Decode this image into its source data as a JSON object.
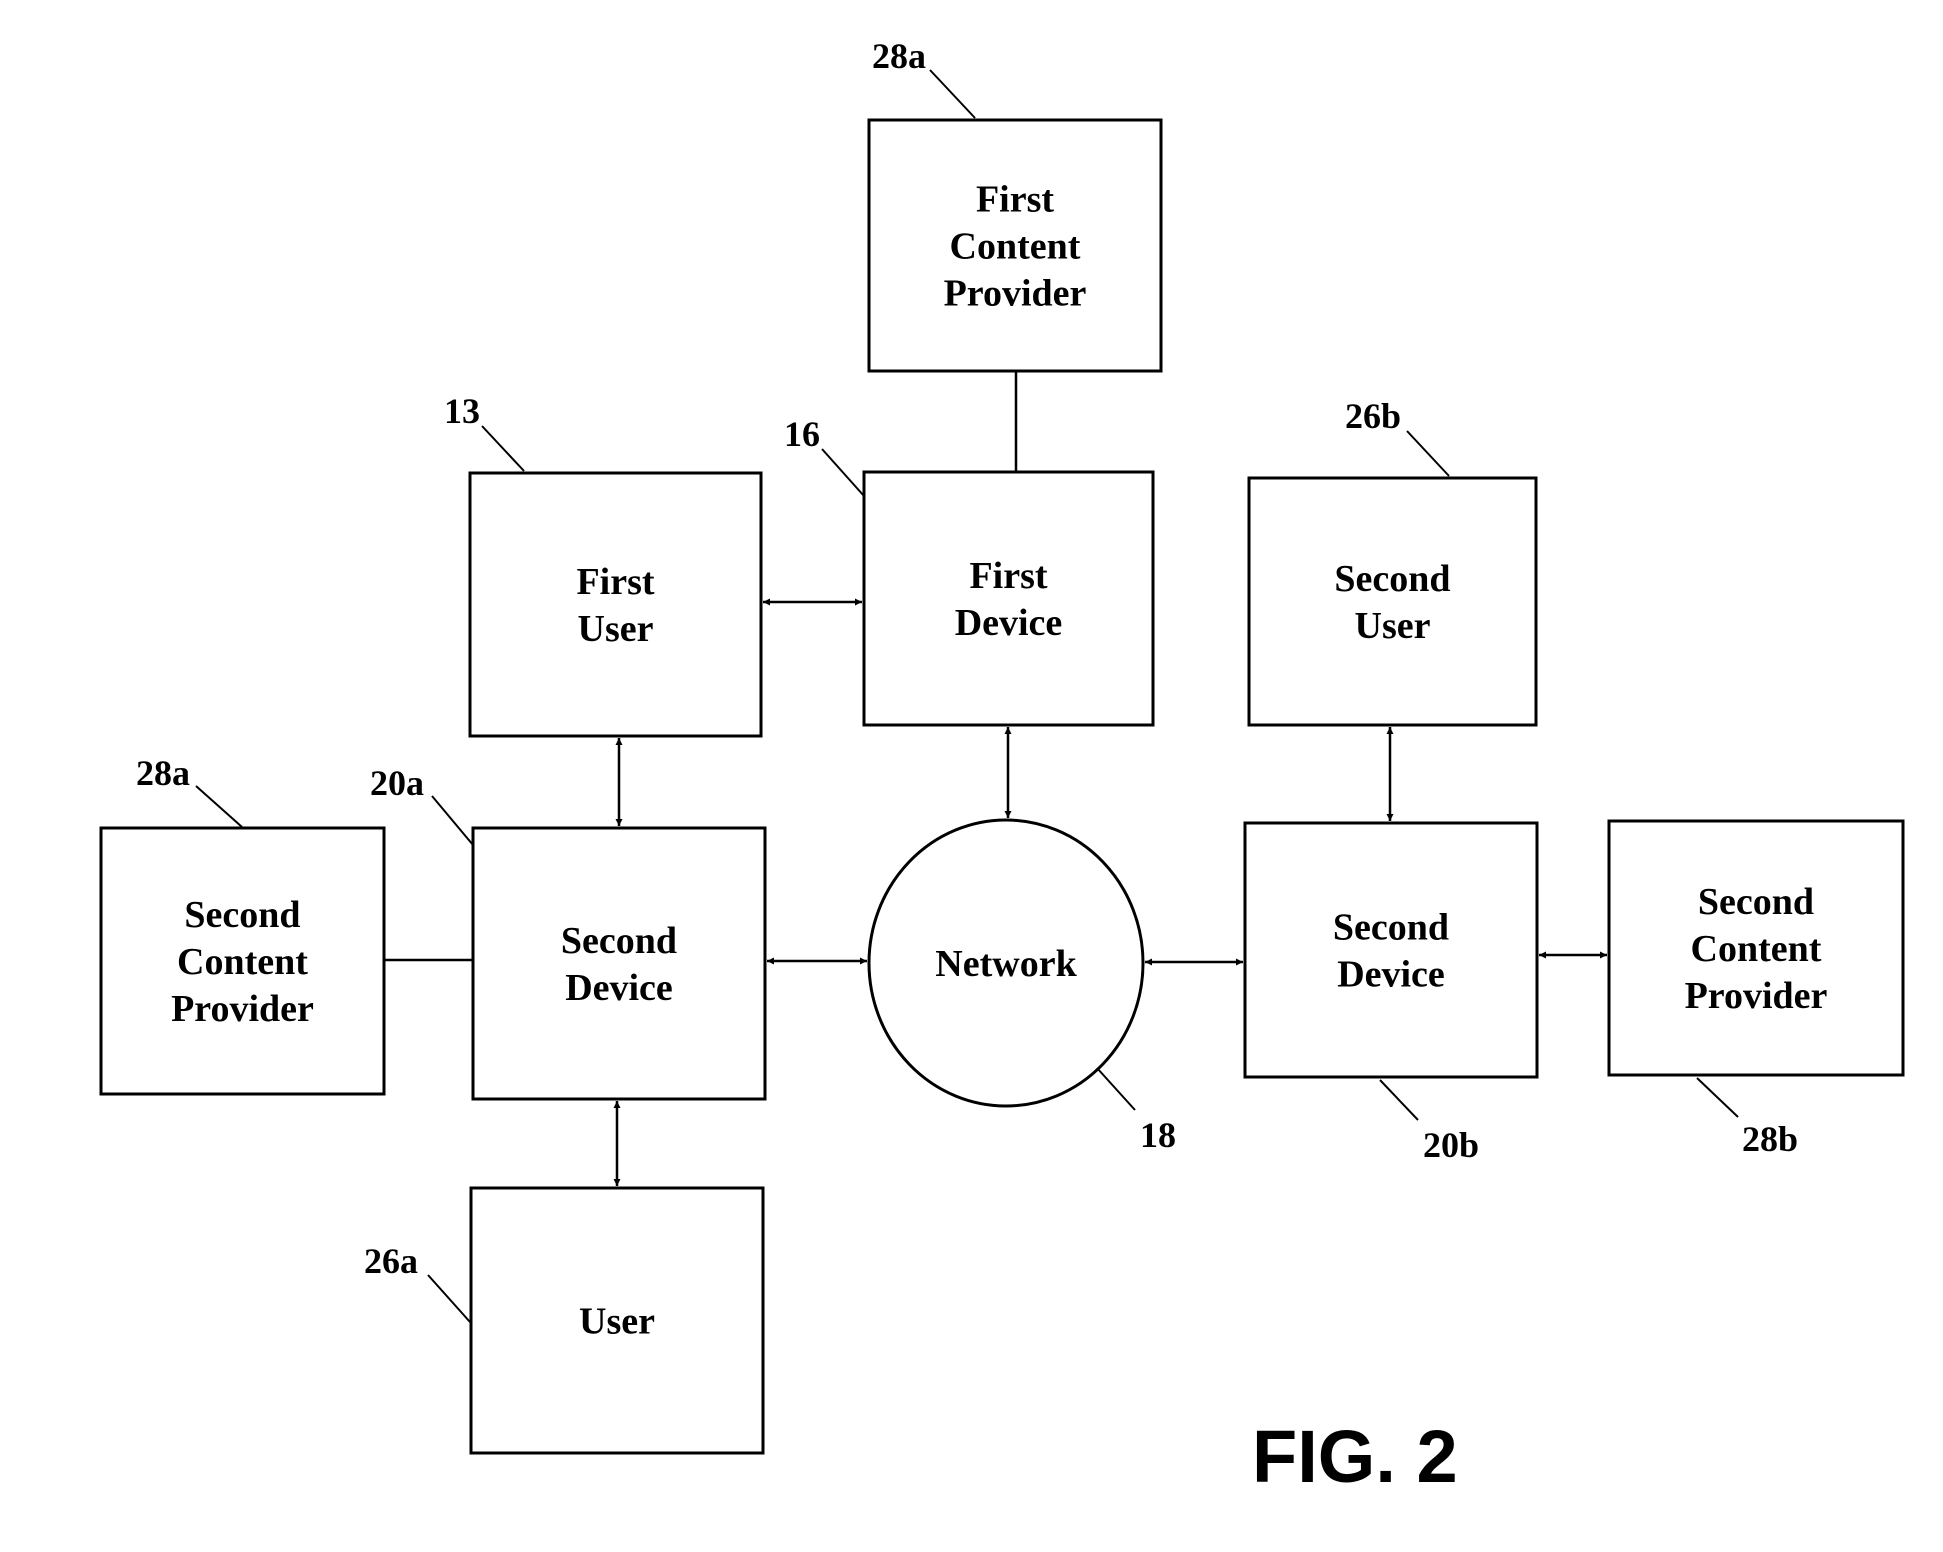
{
  "figure": {
    "title": "FIG. 2"
  },
  "nodes": [
    {
      "id": "first-content-provider",
      "ref": "28a",
      "lines": [
        "First",
        "Content",
        "Provider"
      ]
    },
    {
      "id": "first-user",
      "ref": "13",
      "lines": [
        "First",
        "User"
      ]
    },
    {
      "id": "first-device",
      "ref": "16",
      "lines": [
        "First",
        "Device"
      ]
    },
    {
      "id": "second-user",
      "ref": "26b",
      "lines": [
        "Second",
        "User"
      ]
    },
    {
      "id": "second-content-provider-left",
      "ref": "28a",
      "lines": [
        "Second",
        "Content",
        "Provider"
      ]
    },
    {
      "id": "second-device-left",
      "ref": "20a",
      "lines": [
        "Second",
        "Device"
      ]
    },
    {
      "id": "network",
      "ref": "18",
      "lines": [
        "Network"
      ]
    },
    {
      "id": "second-device-right",
      "ref": "20b",
      "lines": [
        "Second",
        "Device"
      ]
    },
    {
      "id": "second-content-provider-right",
      "ref": "28b",
      "lines": [
        "Second",
        "Content",
        "Provider"
      ]
    },
    {
      "id": "user",
      "ref": "26a",
      "lines": [
        "User"
      ]
    }
  ],
  "edges": [
    {
      "from": "first-content-provider",
      "to": "first-device",
      "type": "line"
    },
    {
      "from": "first-user",
      "to": "first-device",
      "type": "bidirectional"
    },
    {
      "from": "first-user",
      "to": "second-device-left",
      "type": "bidirectional"
    },
    {
      "from": "first-device",
      "to": "network",
      "type": "bidirectional"
    },
    {
      "from": "second-user",
      "to": "second-device-right",
      "type": "bidirectional"
    },
    {
      "from": "second-content-provider-left",
      "to": "second-device-left",
      "type": "line"
    },
    {
      "from": "second-device-left",
      "to": "network",
      "type": "bidirectional"
    },
    {
      "from": "network",
      "to": "second-device-right",
      "type": "bidirectional"
    },
    {
      "from": "second-device-right",
      "to": "second-content-provider-right",
      "type": "bidirectional"
    },
    {
      "from": "second-device-left",
      "to": "user",
      "type": "bidirectional"
    }
  ]
}
